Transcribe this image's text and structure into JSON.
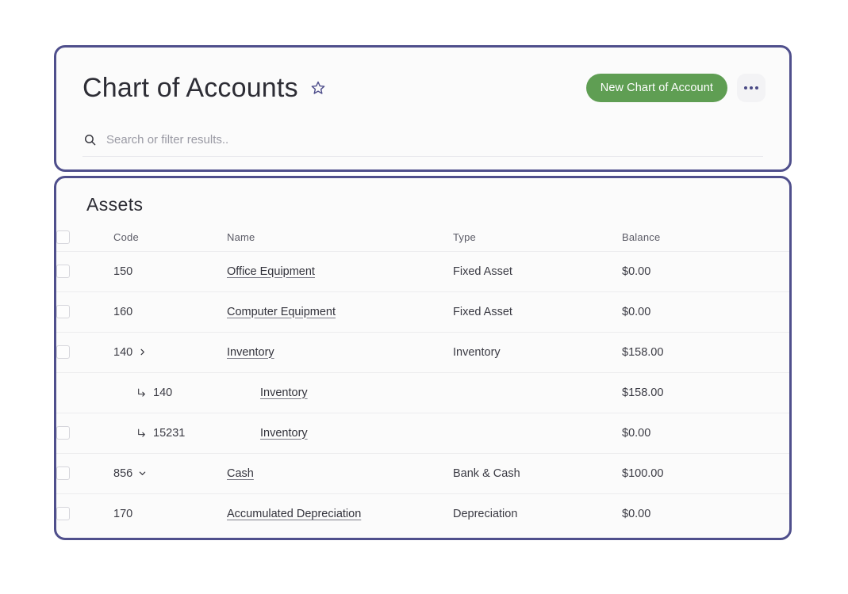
{
  "header": {
    "title": "Chart of Accounts",
    "favorite_icon": "star-outline-icon",
    "primary_button": "New Chart of Account",
    "more_button": "more-horizontal-icon",
    "accent_green": "#5f9e53",
    "accent_purple": "#4f4f8c"
  },
  "search": {
    "icon": "search-icon",
    "value": "",
    "placeholder": "Search or filter results.."
  },
  "table": {
    "section_title": "Assets",
    "columns": [
      "Code",
      "Name",
      "Type",
      "Balance"
    ],
    "rows": [
      {
        "checkbox": true,
        "code": "150",
        "expander": "",
        "child": false,
        "name": "Office Equipment",
        "type": "Fixed Asset",
        "balance": "$0.00"
      },
      {
        "checkbox": true,
        "code": "160",
        "expander": "",
        "child": false,
        "name": "Computer Equipment",
        "type": "Fixed Asset",
        "balance": "$0.00"
      },
      {
        "checkbox": true,
        "code": "140",
        "expander": "chevron-right-icon",
        "child": false,
        "name": "Inventory",
        "type": "Inventory",
        "balance": "$158.00"
      },
      {
        "checkbox": false,
        "code": "140",
        "expander": "",
        "child": true,
        "name": "Inventory",
        "type": "",
        "balance": "$158.00"
      },
      {
        "checkbox": true,
        "code": "15231",
        "expander": "",
        "child": true,
        "name": "Inventory",
        "type": "",
        "balance": "$0.00"
      },
      {
        "checkbox": true,
        "code": "856",
        "expander": "chevron-down-icon",
        "child": false,
        "name": "Cash",
        "type": "Bank & Cash",
        "balance": "$100.00"
      },
      {
        "checkbox": true,
        "code": "170",
        "expander": "",
        "child": false,
        "name": "Accumulated Depreciation",
        "type": "Depreciation",
        "balance": "$0.00"
      }
    ]
  }
}
